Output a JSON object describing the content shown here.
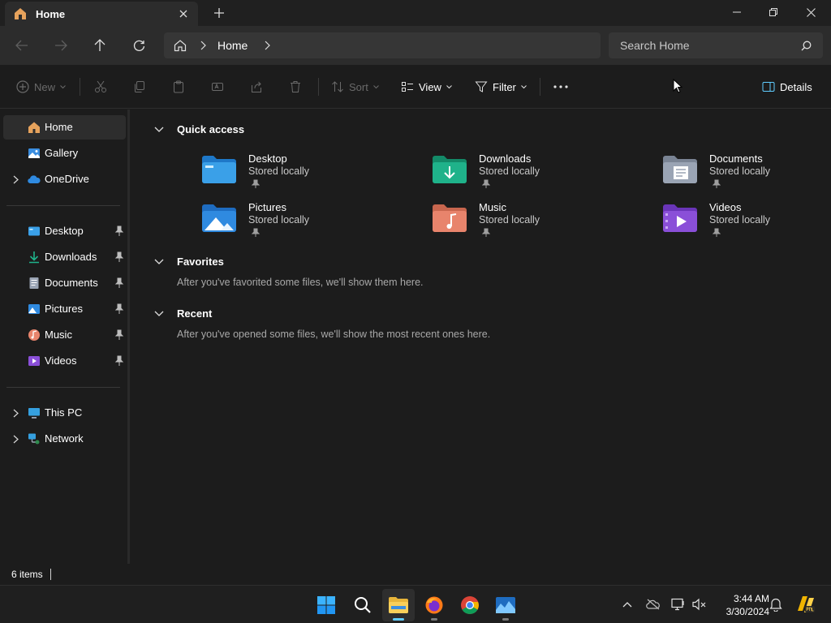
{
  "window": {
    "tab_title": "Home",
    "tab_close_icon": "close-icon",
    "new_tab_icon": "plus-icon"
  },
  "nav": {
    "address_crumb": "Home",
    "search_placeholder": "Search Home"
  },
  "toolbar": {
    "new_label": "New",
    "sort_label": "Sort",
    "view_label": "View",
    "filter_label": "Filter",
    "details_label": "Details"
  },
  "sidebar": {
    "top": [
      {
        "label": "Home",
        "icon": "home-icon",
        "selected": true
      },
      {
        "label": "Gallery",
        "icon": "gallery-icon"
      },
      {
        "label": "OneDrive",
        "icon": "onedrive-icon",
        "expandable": true
      }
    ],
    "pinned": [
      {
        "label": "Desktop",
        "icon": "desktop-folder-icon"
      },
      {
        "label": "Downloads",
        "icon": "downloads-folder-icon"
      },
      {
        "label": "Documents",
        "icon": "documents-folder-icon"
      },
      {
        "label": "Pictures",
        "icon": "pictures-folder-icon"
      },
      {
        "label": "Music",
        "icon": "music-folder-icon"
      },
      {
        "label": "Videos",
        "icon": "videos-folder-icon"
      }
    ],
    "bottom": [
      {
        "label": "This PC",
        "icon": "this-pc-icon"
      },
      {
        "label": "Network",
        "icon": "network-icon"
      }
    ]
  },
  "main": {
    "quick_access": {
      "title": "Quick access",
      "items": [
        {
          "name": "Desktop",
          "status": "Stored locally",
          "icon": "desktop-folder-icon",
          "color": "#3aa0e8"
        },
        {
          "name": "Downloads",
          "status": "Stored locally",
          "icon": "downloads-folder-icon",
          "color": "#1fb28a"
        },
        {
          "name": "Documents",
          "status": "Stored locally",
          "icon": "documents-folder-icon",
          "color": "#9aa4b4"
        },
        {
          "name": "Pictures",
          "status": "Stored locally",
          "icon": "pictures-folder-icon",
          "color": "#2f8ae0"
        },
        {
          "name": "Music",
          "status": "Stored locally",
          "icon": "music-folder-icon",
          "color": "#e8846c"
        },
        {
          "name": "Videos",
          "status": "Stored locally",
          "icon": "videos-folder-icon",
          "color": "#8a4fd8"
        }
      ]
    },
    "favorites": {
      "title": "Favorites",
      "message": "After you've favorited some files, we'll show them here."
    },
    "recent": {
      "title": "Recent",
      "message": "After you've opened some files, we'll show the most recent ones here."
    }
  },
  "status": {
    "item_count": "6 items"
  },
  "taskbar": {
    "apps": [
      "start-icon",
      "search-icon",
      "file-explorer-icon",
      "firefox-icon",
      "chrome-icon",
      "photos-icon"
    ],
    "time": "3:44 AM",
    "date": "3/30/2024"
  },
  "colors": {
    "accent": "#60cdff",
    "background": "#1c1c1c"
  }
}
